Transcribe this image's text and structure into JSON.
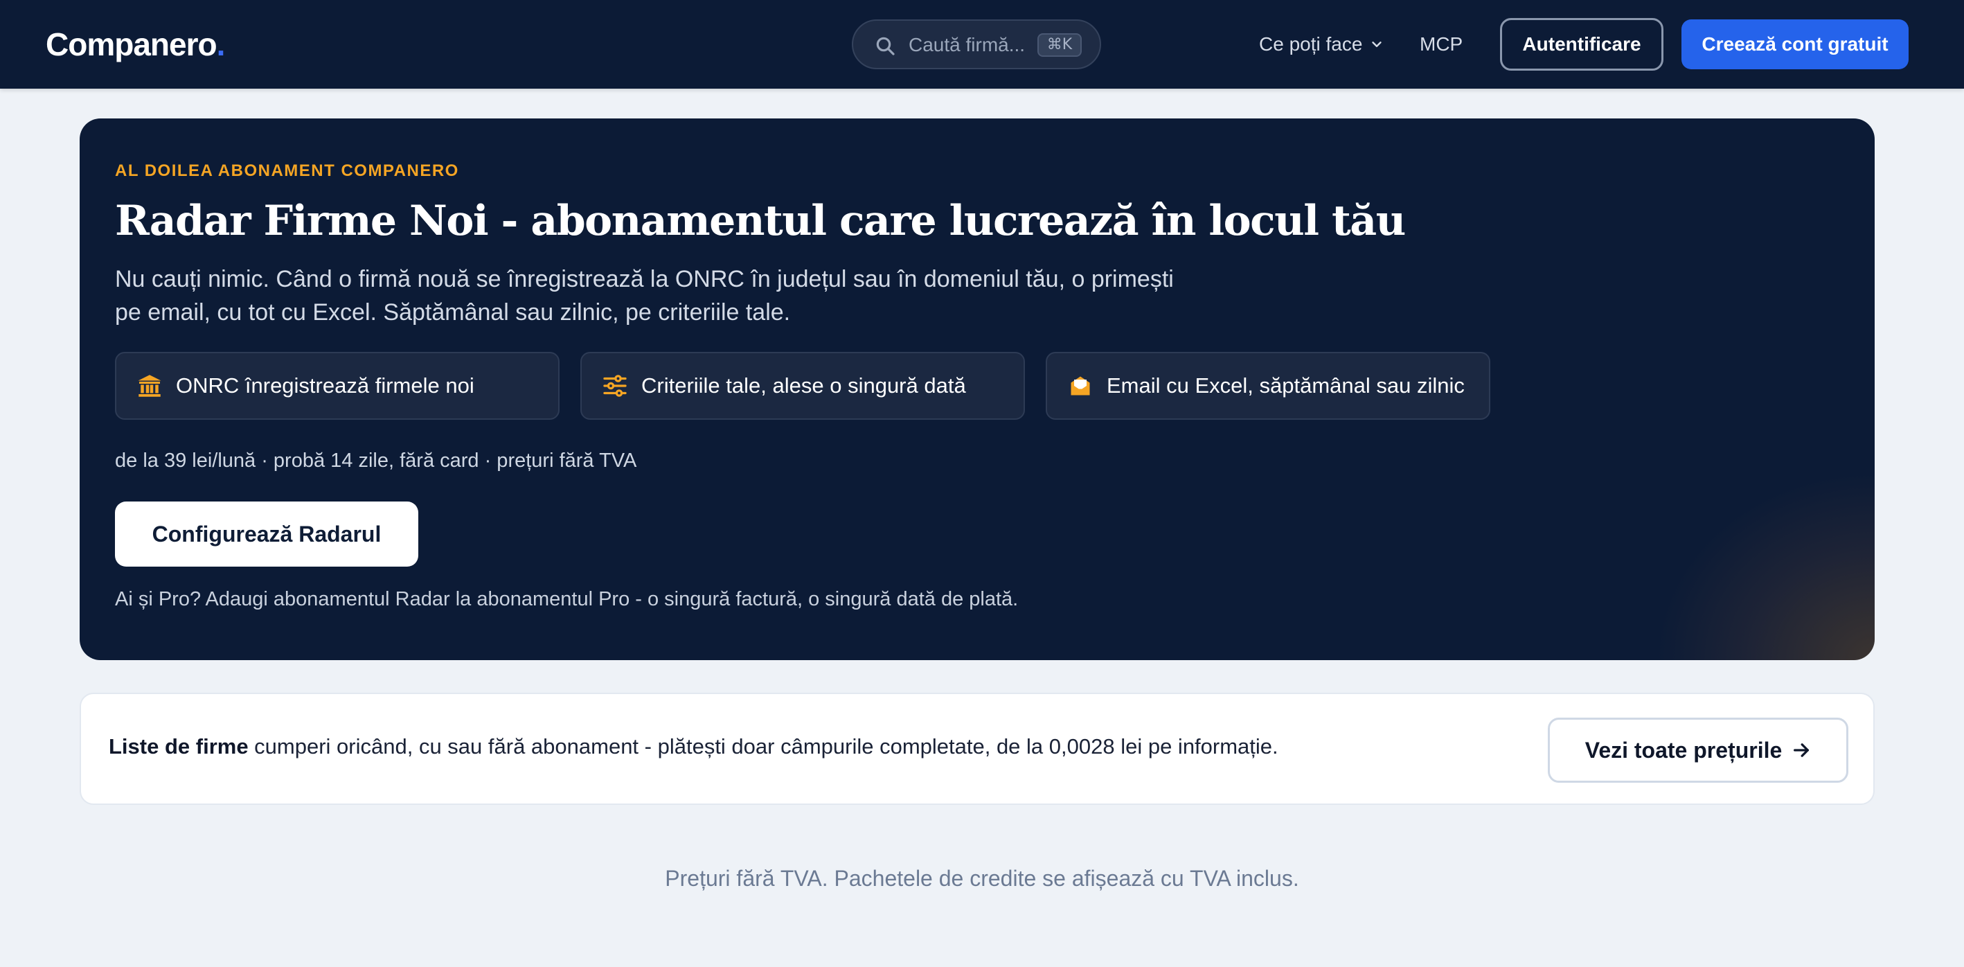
{
  "header": {
    "logo_text": "Companero",
    "logo_dot": ".",
    "search": {
      "placeholder": "Caută firmă...",
      "shortcut": "⌘K"
    },
    "nav": {
      "menu_label": "Ce poți face",
      "mcp_label": "MCP"
    },
    "login_label": "Autentificare",
    "signup_label": "Creează cont gratuit"
  },
  "hero": {
    "eyebrow": "AL DOILEA ABONAMENT COMPANERO",
    "title": "Radar Firme Noi - abonamentul care lucrează în locul tău",
    "description": "Nu cauți nimic. Când o firmă nouă se înregistrează la ONRC în județul sau în domeniul tău, o primești pe email, cu tot cu Excel. Săptămânal sau zilnic, pe criteriile tale.",
    "features": [
      {
        "icon": "bank-icon",
        "label": "ONRC înregistrează firmele noi"
      },
      {
        "icon": "sliders-icon",
        "label": "Criteriile tale, alese o singură dată"
      },
      {
        "icon": "mail-open-icon",
        "label": "Email cu Excel, săptămânal sau zilnic"
      }
    ],
    "price_line": "de la 39 lei/lună · probă 14 zile, fără card · prețuri fără TVA",
    "cta_label": "Configurează Radarul",
    "pro_note": "Ai și Pro? Adaugi abonamentul Radar la abonamentul Pro - o singură factură, o singură dată de plată."
  },
  "lists_banner": {
    "bold": "Liste de firme",
    "text": " cumperi oricând, cu sau fără abonament - plătești doar câmpurile completate, de la 0,0028 lei pe informație.",
    "button_label": "Vezi toate prețurile"
  },
  "footnote": "Prețuri fără TVA. Pachetele de credite se afișează cu TVA inclus.",
  "colors": {
    "nav_bg": "#0c1b36",
    "accent_blue": "#2563eb",
    "accent_orange": "#f5a524",
    "page_bg": "#eef2f7"
  }
}
